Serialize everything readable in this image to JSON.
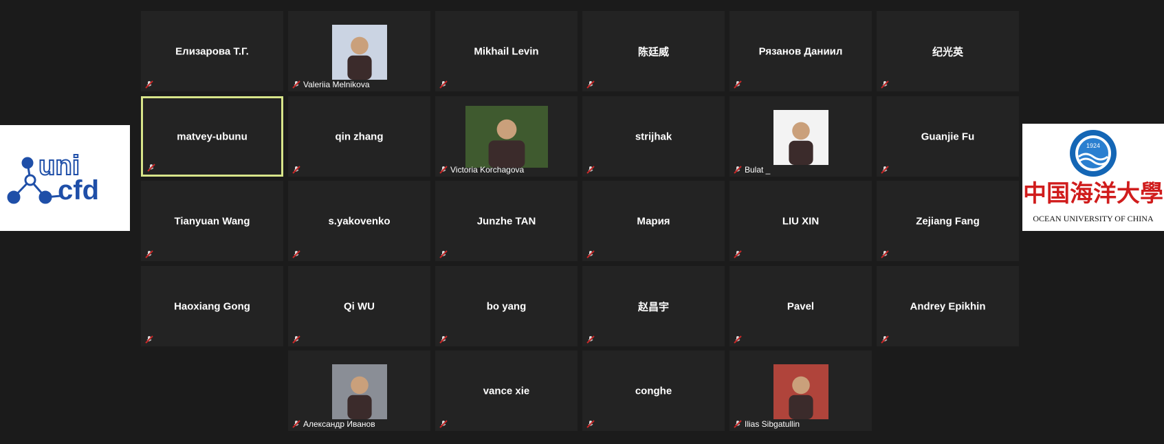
{
  "colors": {
    "background": "#1b1b1b",
    "tile": "#232323",
    "active_border": "#d8e58a",
    "muted_icon": "#c62828"
  },
  "logos": {
    "left": {
      "text_top": "uni",
      "text_bottom": "cfd"
    },
    "right": {
      "chinese": "中国海洋大學",
      "english": "OCEAN UNIVERSITY OF CHINA",
      "seal_year": "1924"
    }
  },
  "participants": [
    {
      "name": "Елизарова Т.Г.",
      "video": false
    },
    {
      "name": "Valeriia Melnikova",
      "video": true
    },
    {
      "name": "Mikhail Levin",
      "video": false
    },
    {
      "name": "陈廷威",
      "video": false
    },
    {
      "name": "Рязанов Даниил",
      "video": false
    },
    {
      "name": "纪光英",
      "video": false
    },
    {
      "name": "matvey-ubunu",
      "video": false,
      "active": true
    },
    {
      "name": "qin zhang",
      "video": false
    },
    {
      "name": "Victoria Korchagova",
      "video": true
    },
    {
      "name": "strijhak",
      "video": false
    },
    {
      "name": "Bulat _",
      "video": true
    },
    {
      "name": "Guanjie Fu",
      "video": false
    },
    {
      "name": "Tianyuan Wang",
      "video": false
    },
    {
      "name": "s.yakovenko",
      "video": false
    },
    {
      "name": "Junzhe TAN",
      "video": false
    },
    {
      "name": "Мария",
      "video": false
    },
    {
      "name": "LIU XIN",
      "video": false
    },
    {
      "name": "Zejiang Fang",
      "video": false
    },
    {
      "name": "Haoxiang Gong",
      "video": false
    },
    {
      "name": "Qi WU",
      "video": false
    },
    {
      "name": "bo yang",
      "video": false
    },
    {
      "name": "赵昌宇",
      "video": false
    },
    {
      "name": "Pavel",
      "video": false
    },
    {
      "name": "Andrey Epikhin",
      "video": false
    },
    {
      "name": "Александр Иванов",
      "video": true
    },
    {
      "name": "vance xie",
      "video": false
    },
    {
      "name": "conghe",
      "video": false
    },
    {
      "name": "Ilias Sibgatullin",
      "video": true
    }
  ]
}
